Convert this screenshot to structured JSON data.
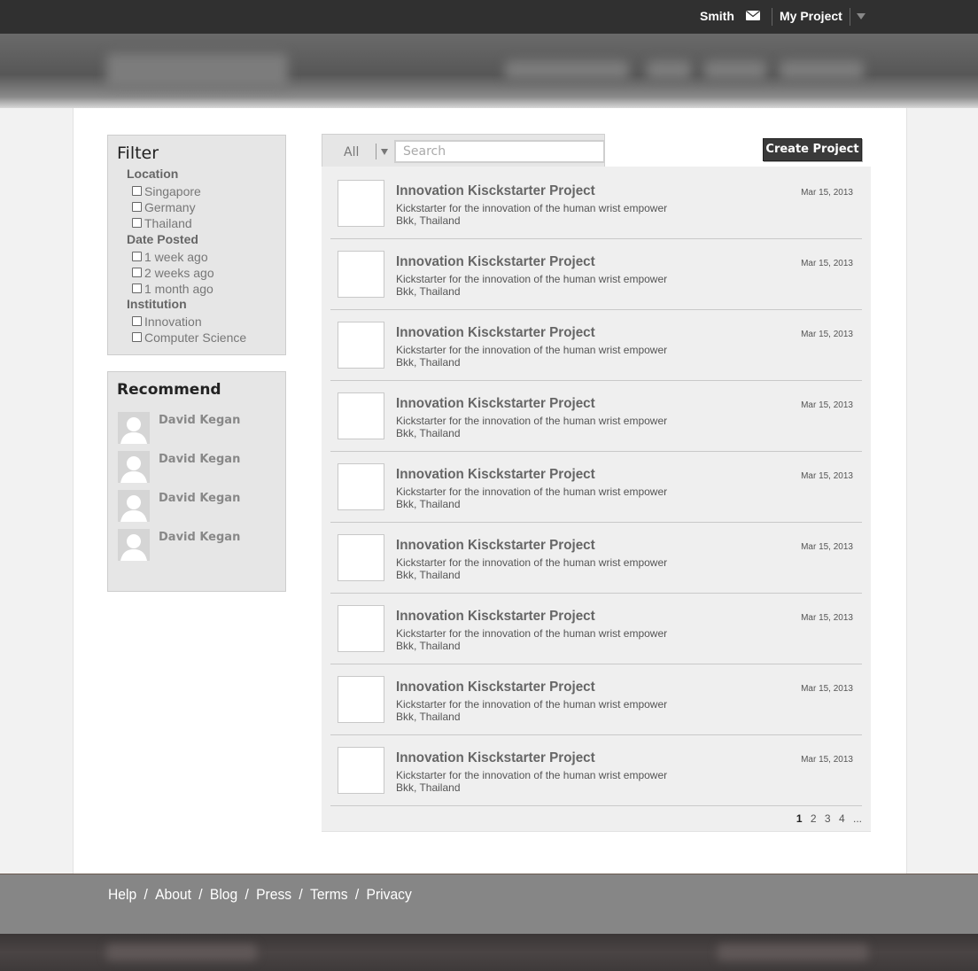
{
  "topbar": {
    "user_name": "Smith",
    "my_project_label": "My Project"
  },
  "filter": {
    "title": "Filter",
    "groups": [
      {
        "label": "Location",
        "options": [
          "Singapore",
          "Germany",
          "Thailand"
        ]
      },
      {
        "label": "Date Posted",
        "options": [
          "1 week ago",
          "2 weeks ago",
          "1 month ago"
        ]
      },
      {
        "label": "Institution",
        "options": [
          "Innovation",
          "Computer Science"
        ]
      }
    ]
  },
  "recommend": {
    "title": "Recommend",
    "people": [
      "David Kegan",
      "David Kegan",
      "David Kegan",
      "David Kegan"
    ]
  },
  "search": {
    "scope_label": "All",
    "placeholder": "Search",
    "value": ""
  },
  "create_button_label": "Create Project",
  "projects": [
    {
      "title": "Innovation Kisckstarter Project",
      "description": "Kickstarter for the innovation of the human wrist empower",
      "location": "Bkk, Thailand",
      "date": "Mar 15, 2013"
    },
    {
      "title": "Innovation Kisckstarter Project",
      "description": "Kickstarter for the innovation of the human wrist empower",
      "location": "Bkk, Thailand",
      "date": "Mar 15, 2013"
    },
    {
      "title": "Innovation Kisckstarter Project",
      "description": "Kickstarter for the innovation of the human wrist empower",
      "location": "Bkk, Thailand",
      "date": "Mar 15, 2013"
    },
    {
      "title": "Innovation Kisckstarter Project",
      "description": "Kickstarter for the innovation of the human wrist empower",
      "location": "Bkk, Thailand",
      "date": "Mar 15, 2013"
    },
    {
      "title": "Innovation Kisckstarter Project",
      "description": "Kickstarter for the innovation of the human wrist empower",
      "location": "Bkk, Thailand",
      "date": "Mar 15, 2013"
    },
    {
      "title": "Innovation Kisckstarter Project",
      "description": "Kickstarter for the innovation of the human wrist empower",
      "location": "Bkk, Thailand",
      "date": "Mar 15, 2013"
    },
    {
      "title": "Innovation Kisckstarter Project",
      "description": "Kickstarter for the innovation of the human wrist empower",
      "location": "Bkk, Thailand",
      "date": "Mar 15, 2013"
    },
    {
      "title": "Innovation Kisckstarter Project",
      "description": "Kickstarter for the innovation of the human wrist empower",
      "location": "Bkk, Thailand",
      "date": "Mar 15, 2013"
    },
    {
      "title": "Innovation Kisckstarter Project",
      "description": "Kickstarter for the innovation of the human wrist empower",
      "location": "Bkk, Thailand",
      "date": "Mar 15, 2013"
    }
  ],
  "pagination": {
    "pages": [
      "1",
      "2",
      "3",
      "4"
    ],
    "current": "1",
    "more": "..."
  },
  "footer": {
    "links": [
      "Help",
      "About",
      "Blog",
      "Press",
      "Terms",
      "Privacy"
    ],
    "separator": "/"
  }
}
